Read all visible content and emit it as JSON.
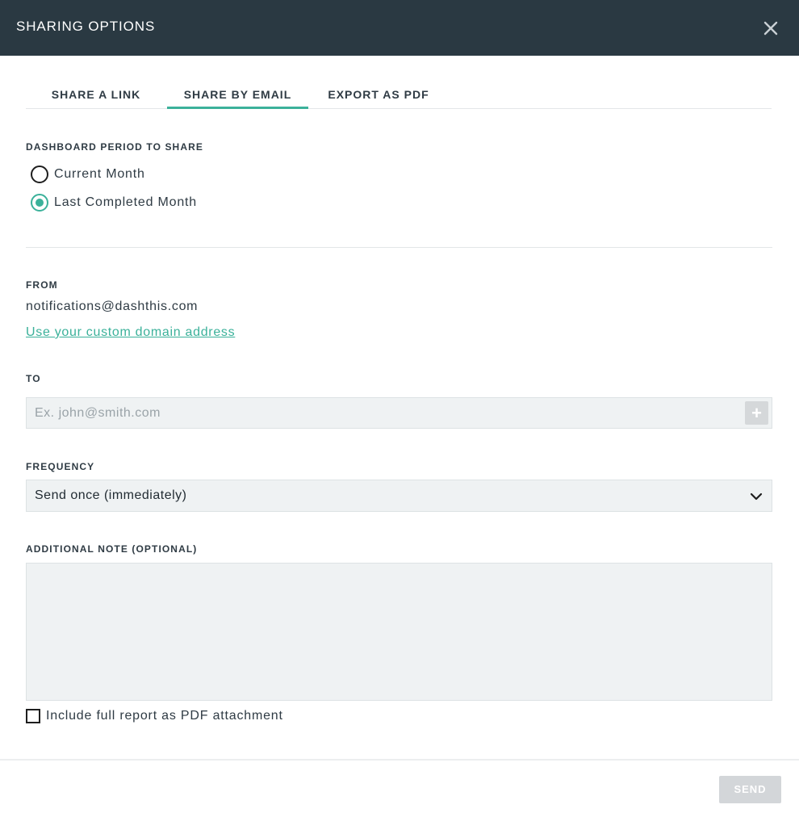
{
  "header": {
    "title": "SHARING OPTIONS",
    "close_icon": "close-icon"
  },
  "tabs": [
    {
      "label": "SHARE A LINK",
      "active": false
    },
    {
      "label": "SHARE BY EMAIL",
      "active": true
    },
    {
      "label": "EXPORT AS PDF",
      "active": false
    }
  ],
  "period": {
    "label": "DASHBOARD PERIOD TO SHARE",
    "options": [
      {
        "label": "Current Month",
        "checked": false
      },
      {
        "label": "Last Completed Month",
        "checked": true
      }
    ]
  },
  "from": {
    "label": "FROM",
    "value": "notifications@dashthis.com",
    "link": "Use your custom domain address"
  },
  "to": {
    "label": "TO",
    "placeholder": "Ex. john@smith.com",
    "add_label": "+"
  },
  "frequency": {
    "label": "FREQUENCY",
    "selected": "Send once (immediately)"
  },
  "note": {
    "label": "ADDITIONAL NOTE (OPTIONAL)",
    "value": ""
  },
  "attachment": {
    "label": "Include full report as PDF attachment",
    "checked": false
  },
  "footer": {
    "send_label": "SEND"
  },
  "colors": {
    "accent": "#3bb19a",
    "header_bg": "#2a3942",
    "input_bg": "#eff2f3",
    "button_disabled": "#d3d6d9"
  }
}
